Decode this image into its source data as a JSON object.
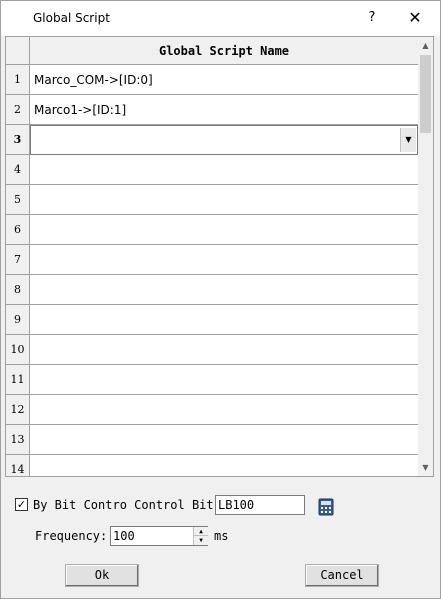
{
  "window": {
    "title": "Global Script",
    "help_label": "?",
    "close_label": "✕"
  },
  "grid": {
    "column_header": "Global Script Name",
    "rows": [
      {
        "num": "1",
        "name": "Marco_COM->[ID:0]"
      },
      {
        "num": "2",
        "name": "Marco1->[ID:1]"
      },
      {
        "num": "3",
        "name": ""
      },
      {
        "num": "4",
        "name": ""
      },
      {
        "num": "5",
        "name": ""
      },
      {
        "num": "6",
        "name": ""
      },
      {
        "num": "7",
        "name": ""
      },
      {
        "num": "8",
        "name": ""
      },
      {
        "num": "9",
        "name": ""
      },
      {
        "num": "10",
        "name": ""
      },
      {
        "num": "11",
        "name": ""
      },
      {
        "num": "12",
        "name": ""
      },
      {
        "num": "13",
        "name": ""
      },
      {
        "num": "14",
        "name": ""
      }
    ],
    "active_row": "3"
  },
  "controls": {
    "by_bit_checked": true,
    "by_bit_label": "By Bit Contro Control Bit:",
    "control_bit_value": "LB100",
    "frequency_label": "Frequency:",
    "frequency_value": "100",
    "frequency_unit": "ms"
  },
  "buttons": {
    "ok_label": "Ok",
    "cancel_label": "Cancel"
  }
}
